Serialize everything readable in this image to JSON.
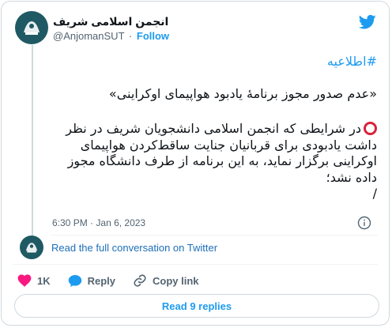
{
  "author": {
    "display_name": "انجمن اسلامی شریف",
    "handle": "@AnjomanSUT",
    "separator": "·",
    "follow_label": "Follow"
  },
  "tweet": {
    "hashtag": "#اطلاعیه",
    "title": "«عدم صدور مجوز برنامهٔ یادبود هواپیمای اوکراینی»",
    "body": "در شرایطی که انجمن اسلامی دانشجویان شریف در نظر داشت یادبودی برای قربانیان جنایت ساقط‌کردن هواپیمای اوکراینی برگزار نماید، به این برنامه از طرف دانشگاه مجوز داده نشد؛",
    "continuation": "/",
    "time": "6:30 PM",
    "date": "Jan 6, 2023",
    "meta_separator": "·"
  },
  "conversation": {
    "read_full_label": "Read the full conversation on Twitter"
  },
  "actions": {
    "like_count": "1K",
    "reply_label": "Reply",
    "copy_link_label": "Copy link"
  },
  "footer": {
    "read_replies_label": "Read 9 replies"
  },
  "colors": {
    "accent": "#1d9bf0",
    "like_red": "#f91880",
    "avatar_bg": "#1f5a64",
    "circle_red": "#d9223a"
  },
  "icons": [
    "twitter-bird-icon",
    "info-icon",
    "heart-icon",
    "reply-bubble-icon",
    "link-icon",
    "red-circle-icon"
  ]
}
